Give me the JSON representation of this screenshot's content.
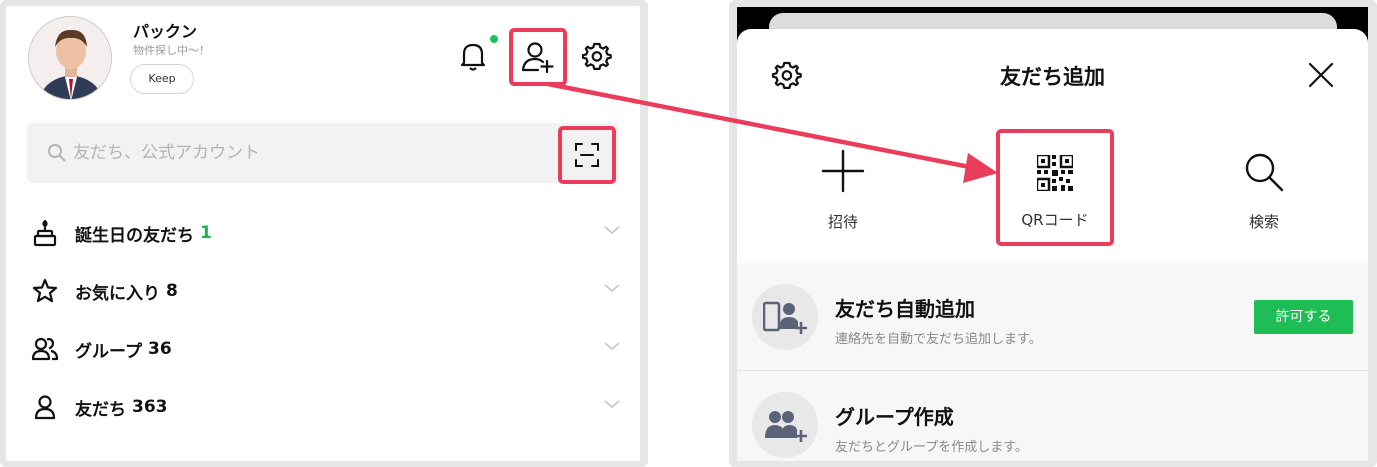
{
  "left": {
    "profile": {
      "name": "パックン",
      "status": "物件探し中〜！",
      "keep_label": "Keep"
    },
    "search": {
      "placeholder": "友だち、公式アカウント"
    },
    "list": [
      {
        "label": "誕生日の友だち",
        "count": "1",
        "icon": "cake-icon"
      },
      {
        "label": "お気に入り",
        "count": "8",
        "icon": "star-icon"
      },
      {
        "label": "グループ",
        "count": "36",
        "icon": "group-icon"
      },
      {
        "label": "友だち",
        "count": "363",
        "icon": "person-icon"
      }
    ]
  },
  "right": {
    "title": "友だち追加",
    "options": [
      {
        "label": "招待",
        "icon": "plus-icon"
      },
      {
        "label": "QRコード",
        "icon": "qr-code-icon"
      },
      {
        "label": "検索",
        "icon": "search-icon"
      }
    ],
    "rows": [
      {
        "title": "友だち自動追加",
        "subtitle": "連絡先を自動で友だち追加します。",
        "button": "許可する",
        "icon": "phone-add-friend-icon"
      },
      {
        "title": "グループ作成",
        "subtitle": "友だちとグループを作成します。",
        "icon": "group-create-icon"
      }
    ]
  },
  "colors": {
    "highlight": "#ea3d5b",
    "accent_green": "#1ebd55",
    "count_green": "#1bb35a",
    "notification": "#19c35b"
  }
}
